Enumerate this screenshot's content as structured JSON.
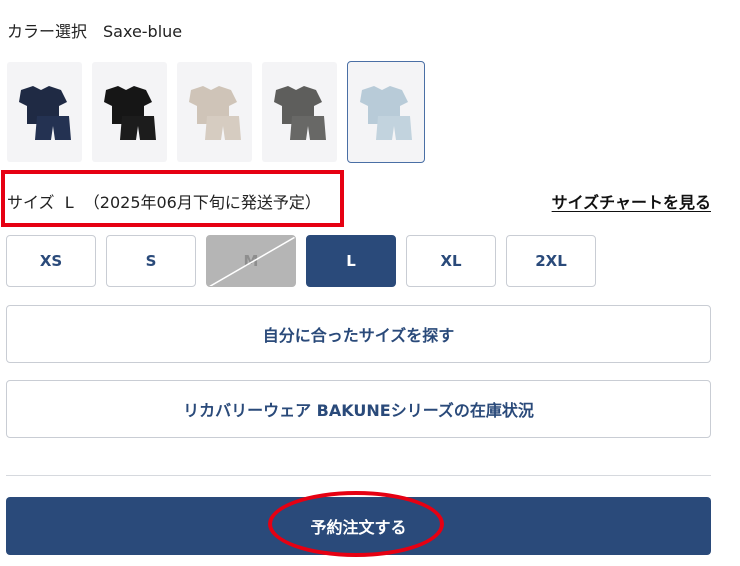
{
  "color": {
    "label": "カラー選択　Saxe-blue",
    "swatches": [
      {
        "name": "Navy",
        "top": "#1f2a44",
        "bottom": "#243252"
      },
      {
        "name": "Black",
        "top": "#161616",
        "bottom": "#1c1c1c"
      },
      {
        "name": "Beige",
        "top": "#cfc4b8",
        "bottom": "#d6ccc1"
      },
      {
        "name": "Charcoal",
        "top": "#5e5e5c",
        "bottom": "#686866"
      },
      {
        "name": "Saxe-blue",
        "top": "#b8cbd8",
        "bottom": "#c2d3de",
        "selected": true
      }
    ]
  },
  "size": {
    "label": "サイズ  L  （2025年06月下旬に発送予定）",
    "chart_link": "サイズチャートを見る",
    "options": [
      {
        "label": "XS",
        "state": "available"
      },
      {
        "label": "S",
        "state": "available"
      },
      {
        "label": "M",
        "state": "unavailable"
      },
      {
        "label": "L",
        "state": "selected"
      },
      {
        "label": "XL",
        "state": "available"
      },
      {
        "label": "2XL",
        "state": "available"
      }
    ]
  },
  "buttons": {
    "find_size": "自分に合ったサイズを探す",
    "stock_status": "リカバリーウェア BAKUNEシリーズの在庫状況",
    "order": "予約注文する"
  },
  "colors": {
    "accent": "#2a4a7a",
    "highlight": "#e60012"
  }
}
